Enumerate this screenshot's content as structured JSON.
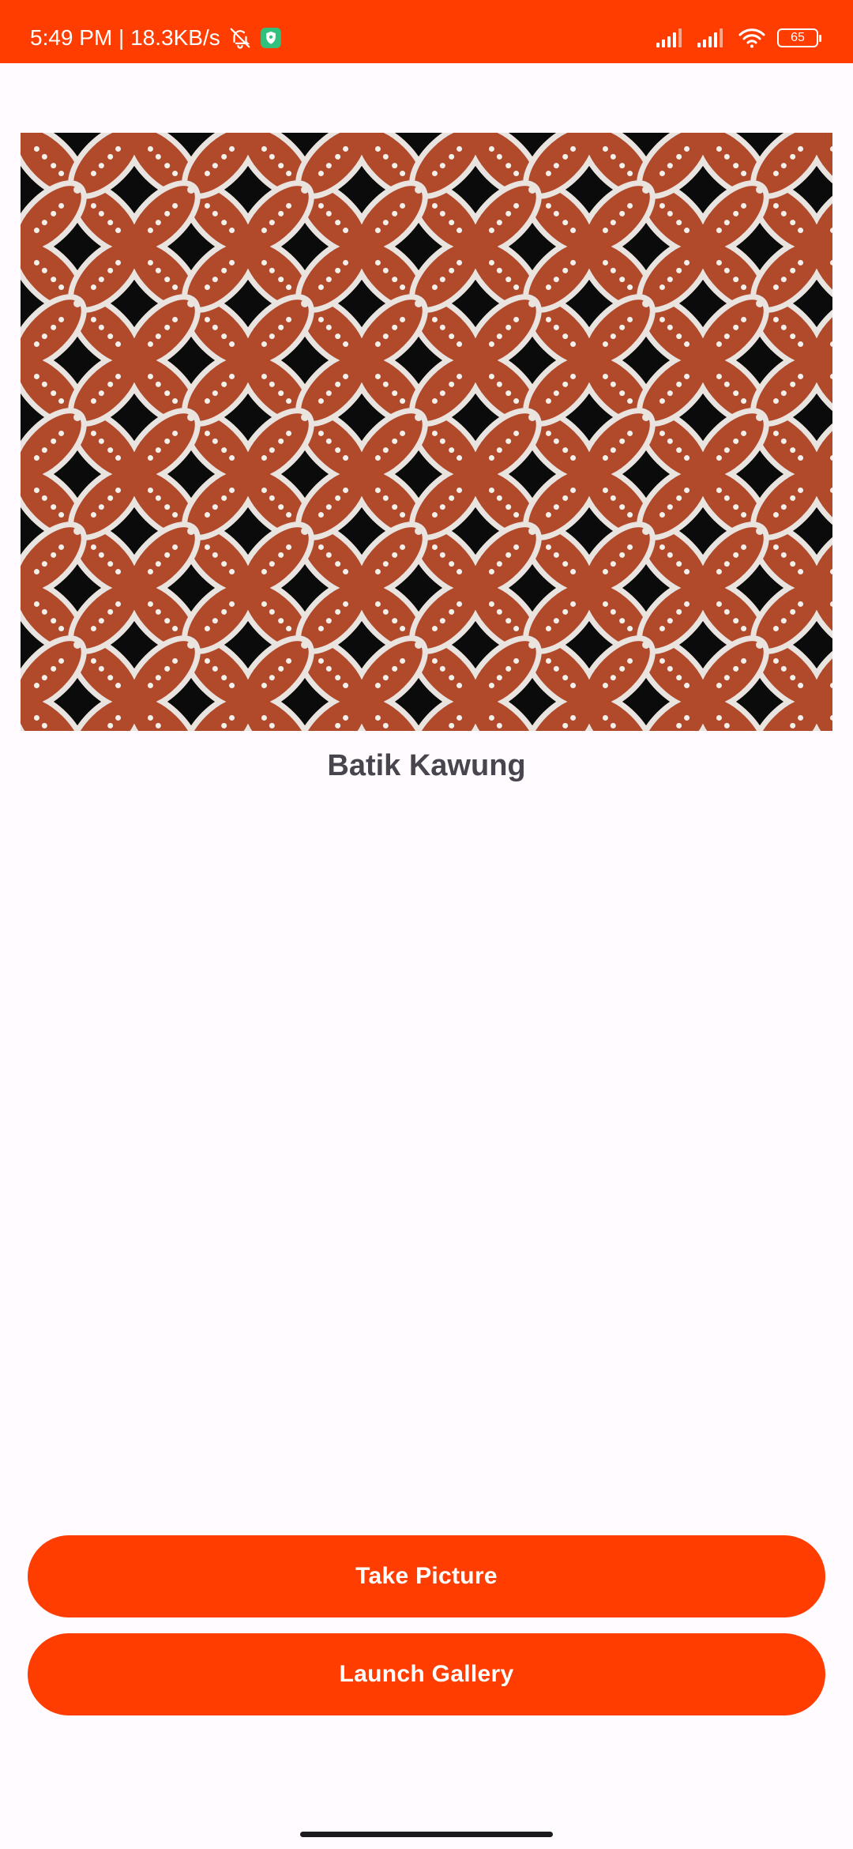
{
  "status_bar": {
    "time_speed": "5:49 PM | 18.3KB/s",
    "battery_level": "65",
    "icons": [
      "mute-bell-icon",
      "vpn-shield-icon",
      "signal-icon",
      "signal-icon",
      "wifi-icon",
      "battery-icon"
    ],
    "background_color": "#FF3D00"
  },
  "main": {
    "image_subject": "batik-kawung-pattern",
    "prediction_label": "Batik Kawung"
  },
  "buttons": {
    "take_picture": "Take Picture",
    "launch_gallery": "Launch Gallery"
  },
  "colors": {
    "accent": "#FF3D00",
    "label_text": "#49454F",
    "background": "#FFFBFE",
    "kawung_petal": "#B04A2A",
    "kawung_outline": "#E9E4DF"
  }
}
